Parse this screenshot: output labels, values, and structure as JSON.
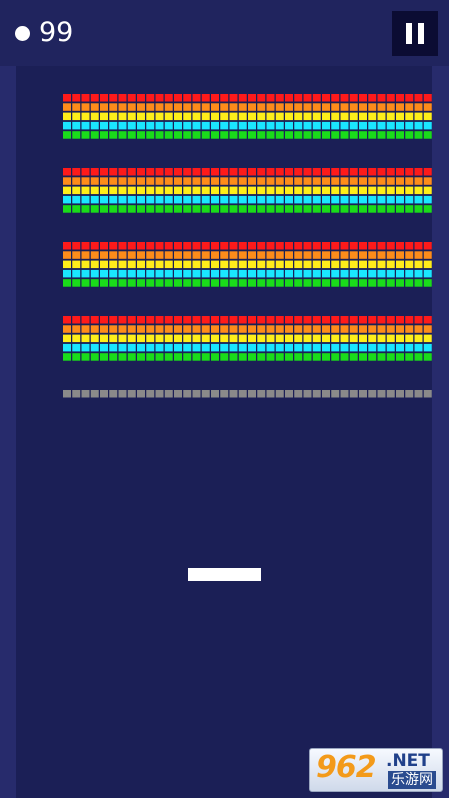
{
  "hud": {
    "ball_icon": "ball-icon",
    "score": "99",
    "pause_icon": "pause-icon"
  },
  "colors": {
    "background": "#20245e",
    "playfield": "#1b1f56",
    "brick_rows": [
      "#ff1a1a",
      "#ff8c1a",
      "#ffee1a",
      "#1ae6ff",
      "#1adc1a"
    ],
    "steel_row": "#8a8a8a",
    "paddle": "#ffffff"
  },
  "game": {
    "brick_groups": 4,
    "rows_per_group": 5,
    "bricks_per_row": 40,
    "steel_bricks": 40
  },
  "watermark": {
    "mark": "962",
    "net": ".NET",
    "sub": "乐游网"
  }
}
